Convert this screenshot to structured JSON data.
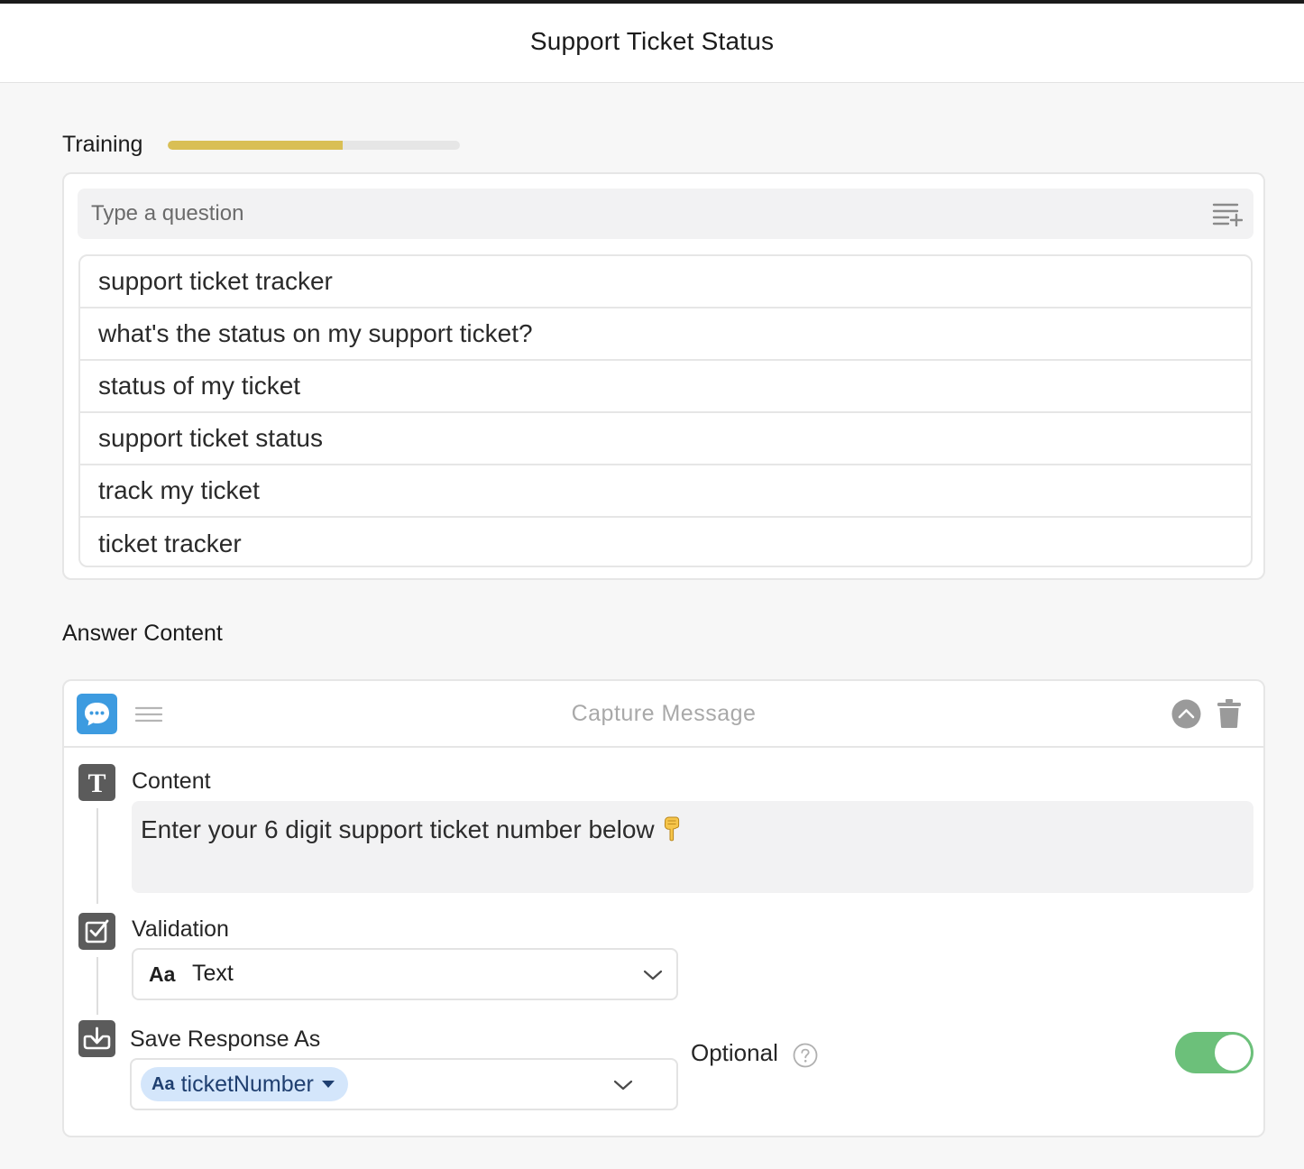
{
  "header": {
    "title": "Support Ticket Status"
  },
  "training": {
    "label": "Training",
    "progress": 0.6,
    "progress_color": "#d9bf55",
    "input_placeholder": "Type a question",
    "add_icon": "list-add-icon",
    "questions": [
      "support ticket tracker",
      "what's the status on my support ticket?",
      "status of my ticket",
      "support ticket status",
      "track my ticket",
      "ticket tracker"
    ]
  },
  "answer": {
    "label": "Answer Content",
    "block_title": "Capture Message",
    "block_icon": "chat-bubble-icon",
    "accent_color": "#3d9be0",
    "content": {
      "label": "Content",
      "text": "Enter your 6 digit support ticket number below"
    },
    "validation": {
      "label": "Validation",
      "type_icon": "Aa",
      "value": "Text"
    },
    "save_response": {
      "label": "Save Response As",
      "chip_icon": "Aa",
      "variable": "ticketNumber"
    },
    "optional": {
      "label": "Optional",
      "enabled": true,
      "toggle_color": "#6cc07a"
    }
  }
}
